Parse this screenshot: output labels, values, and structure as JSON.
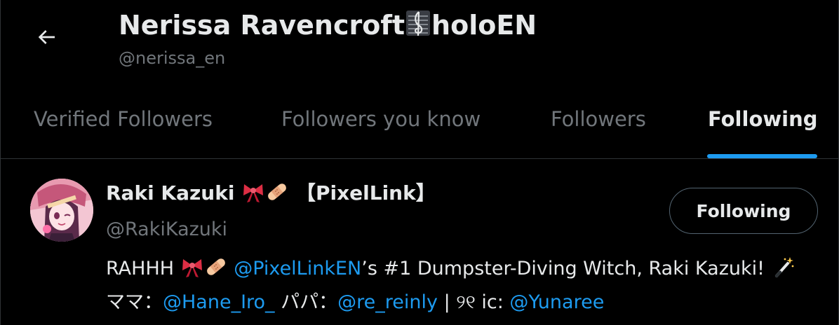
{
  "header": {
    "back_icon": "arrow-left-icon",
    "name_part1": "Nerissa Ravencroft",
    "name_emoji": "musical-score-emoji",
    "name_part2": "holoEN",
    "handle": "@nerissa_en"
  },
  "tabs": [
    {
      "label": "Verified Followers",
      "active": false
    },
    {
      "label": "Followers you know",
      "active": false
    },
    {
      "label": "Followers",
      "active": false
    },
    {
      "label": "Following",
      "active": true
    }
  ],
  "colors": {
    "background": "#000000",
    "text_primary": "#e7e9ea",
    "text_secondary": "#71767b",
    "accent": "#1d9bf0",
    "border": "#2f3336"
  },
  "user": {
    "name_text": "Raki Kazuki",
    "name_emojis": [
      "ribbon-emoji",
      "adhesive-bandage-emoji"
    ],
    "name_suffix": "【PixelLink】",
    "handle": "@RakiKazuki",
    "follow_button_label": "Following",
    "bio": {
      "t1": "RAHHH",
      "mention1": "@PixelLinkEN",
      "t2": "’s #1 Dumpster-Diving Witch, Raki Kazuki!",
      "wand_emoji": "magic-wand-emoji",
      "t3": "ママ：",
      "mention2": "@Hane_Iro_",
      "t4": "パパ：",
      "mention3": "@re_reinly",
      "t5": "| ୨୧ ic:",
      "mention4": "@Yunaree"
    }
  }
}
